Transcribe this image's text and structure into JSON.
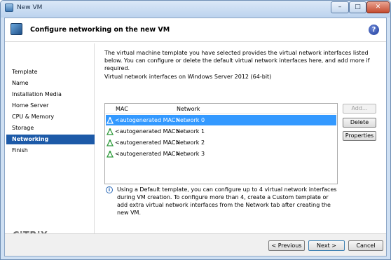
{
  "window": {
    "title": "New VM",
    "minimize_label": "–",
    "maximize_label": "□",
    "close_label": "✕"
  },
  "header": {
    "title": "Configure networking on the new VM",
    "help_label": "?"
  },
  "sidebar": {
    "items": [
      {
        "label": "Template",
        "active": false
      },
      {
        "label": "Name",
        "active": false
      },
      {
        "label": "Installation Media",
        "active": false
      },
      {
        "label": "Home Server",
        "active": false
      },
      {
        "label": "CPU & Memory",
        "active": false
      },
      {
        "label": "Storage",
        "active": false
      },
      {
        "label": "Networking",
        "active": true
      },
      {
        "label": "Finish",
        "active": false
      }
    ],
    "logo": "CiTRiX"
  },
  "main": {
    "intro": "The virtual machine template you have selected provides the virtual network interfaces listed below. You can configure or delete the default virtual network interfaces here, and add more if required.",
    "list_label": "Virtual network interfaces on Windows Server 2012 (64-bit)",
    "columns": {
      "mac": "MAC",
      "network": "Network"
    },
    "rows": [
      {
        "mac": "<autogenerated MAC>",
        "network": "Network 0",
        "selected": true
      },
      {
        "mac": "<autogenerated MAC>",
        "network": "Network 1",
        "selected": false
      },
      {
        "mac": "<autogenerated MAC>",
        "network": "Network 2",
        "selected": false
      },
      {
        "mac": "<autogenerated MAC>",
        "network": "Network 3",
        "selected": false
      }
    ],
    "buttons": {
      "add": "Add...",
      "delete": "Delete",
      "properties": "Properties"
    },
    "info": "Using a Default template, you can configure up to 4 virtual network interfaces during VM creation. To configure more than 4, create a Custom template or add extra virtual network interfaces from the Network tab after creating the new VM.",
    "info_icon": "i"
  },
  "footer": {
    "previous": "< Previous",
    "next": "Next >",
    "cancel": "Cancel"
  },
  "colors": {
    "selection": "#3399ff",
    "nav_active": "#1d5aa8",
    "nic_icon": "#2e9a3a"
  }
}
